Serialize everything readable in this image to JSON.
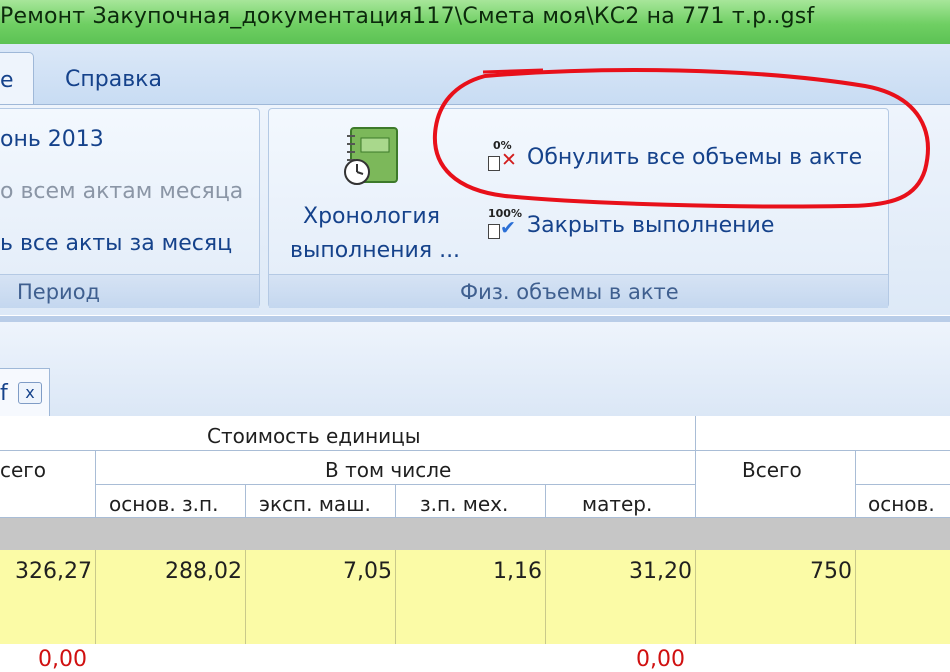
{
  "window": {
    "title": "Ремонт Закупочная_документация117\\Смета моя\\КС2 на 771 т.р..gsf"
  },
  "ribbon_tabs": {
    "active_partial": "е",
    "help": "Справка"
  },
  "period_group": {
    "item1": "онь 2013",
    "item2": "о всем актам месяца",
    "item3": "ь все акты за месяц",
    "label": "Период"
  },
  "phys_group": {
    "chronology_line1": "Хронология",
    "chronology_line2": "выполнения ...",
    "zero_badge": "0%",
    "zero_label": "Обнулить все объемы в акте",
    "full_badge": "100%",
    "close_label": "Закрыть выполнение",
    "label": "Физ. объемы в акте"
  },
  "doc_tab": {
    "label_partial": "f",
    "close_glyph": "x"
  },
  "grid": {
    "header": {
      "unit_cost": "Стоимость единицы",
      "total_partial": "сего",
      "including": "В том числе",
      "osn_zp": "основ. з.п.",
      "eksp_mash": "эксп. маш.",
      "zp_meh": "з.п. мех.",
      "mater": "матер.",
      "total": "Всего",
      "osn_partial": "основ."
    },
    "row": {
      "total": "326,27",
      "osn_zp": "288,02",
      "eksp_mash": "7,05",
      "zp_meh": "1,16",
      "mater": "31,20",
      "grand": "750"
    },
    "next_row": {
      "left": "0,00",
      "right": "0,00"
    }
  },
  "colors": {
    "highlight_circle": "#e8101a",
    "title_bar": "#6fcf63",
    "row_highlight": "#fbfba6"
  },
  "icons": [
    "notebook-clock-icon",
    "zero-percent-delete-icon",
    "hundred-percent-check-icon",
    "close-icon"
  ]
}
